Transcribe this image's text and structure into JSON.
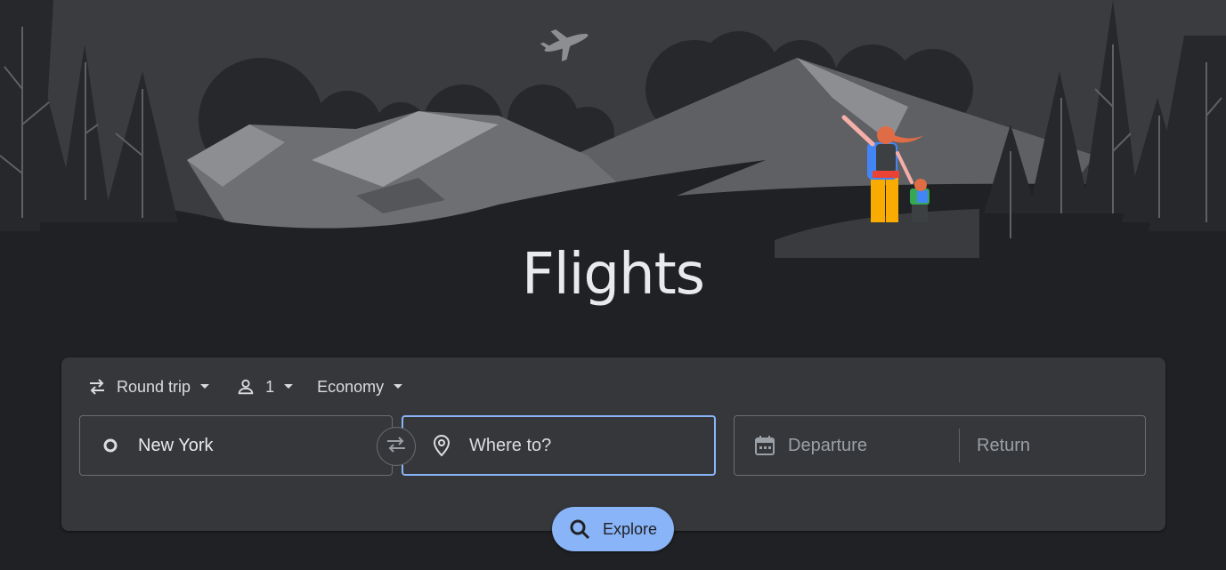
{
  "page": {
    "title": "Flights"
  },
  "search": {
    "trip_type": "Round trip",
    "passengers": "1",
    "cabin_class": "Economy",
    "origin": "New York",
    "destination_placeholder": "Where to?",
    "departure_placeholder": "Departure",
    "return_placeholder": "Return",
    "explore_label": "Explore"
  },
  "colors": {
    "background": "#202124",
    "card": "#36373a",
    "accent": "#8ab4f8"
  }
}
